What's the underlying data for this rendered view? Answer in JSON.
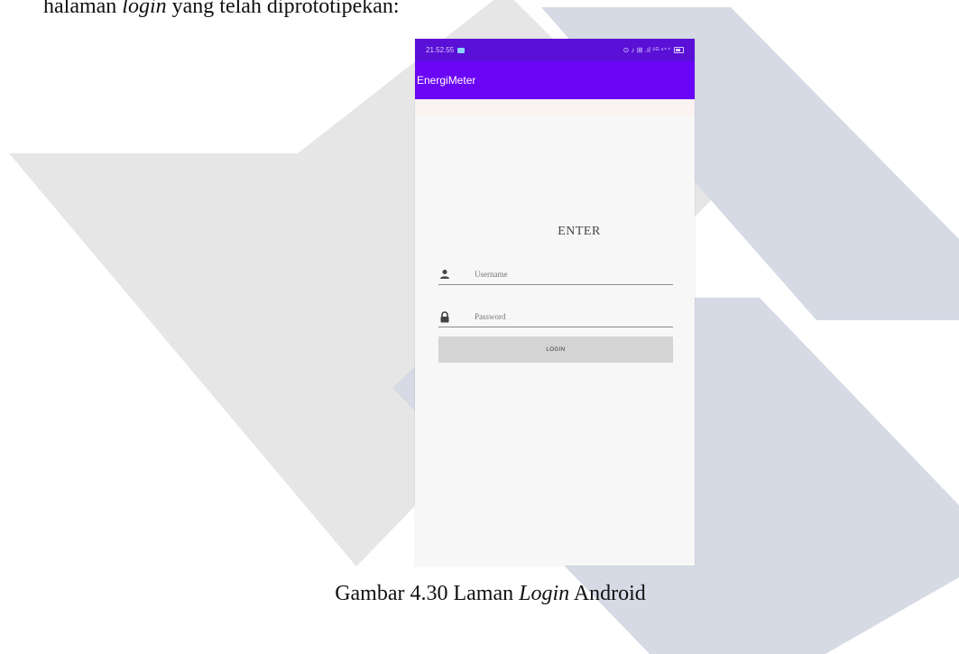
{
  "document": {
    "intro_text_before": "halaman ",
    "intro_text_italic": "login",
    "intro_text_after": " yang telah diprototipekan:",
    "caption_before": "Gambar 4.30 Laman ",
    "caption_italic": "Login",
    "caption_after": " Android"
  },
  "phone": {
    "status": {
      "time": "21.52.55",
      "right_text": "⊙ ♪ ⊞ .ıl ⁵ᴳ ⁿ⁺⁺"
    },
    "app_title": "EnergiMeter",
    "heading": "ENTER",
    "username_placeholder": "Username",
    "password_placeholder": "Password",
    "login_label": "LOGIN",
    "colors": {
      "status_bar": "#5a10d6",
      "app_bar": "#6b05f5",
      "button": "#d4d4d4"
    }
  }
}
